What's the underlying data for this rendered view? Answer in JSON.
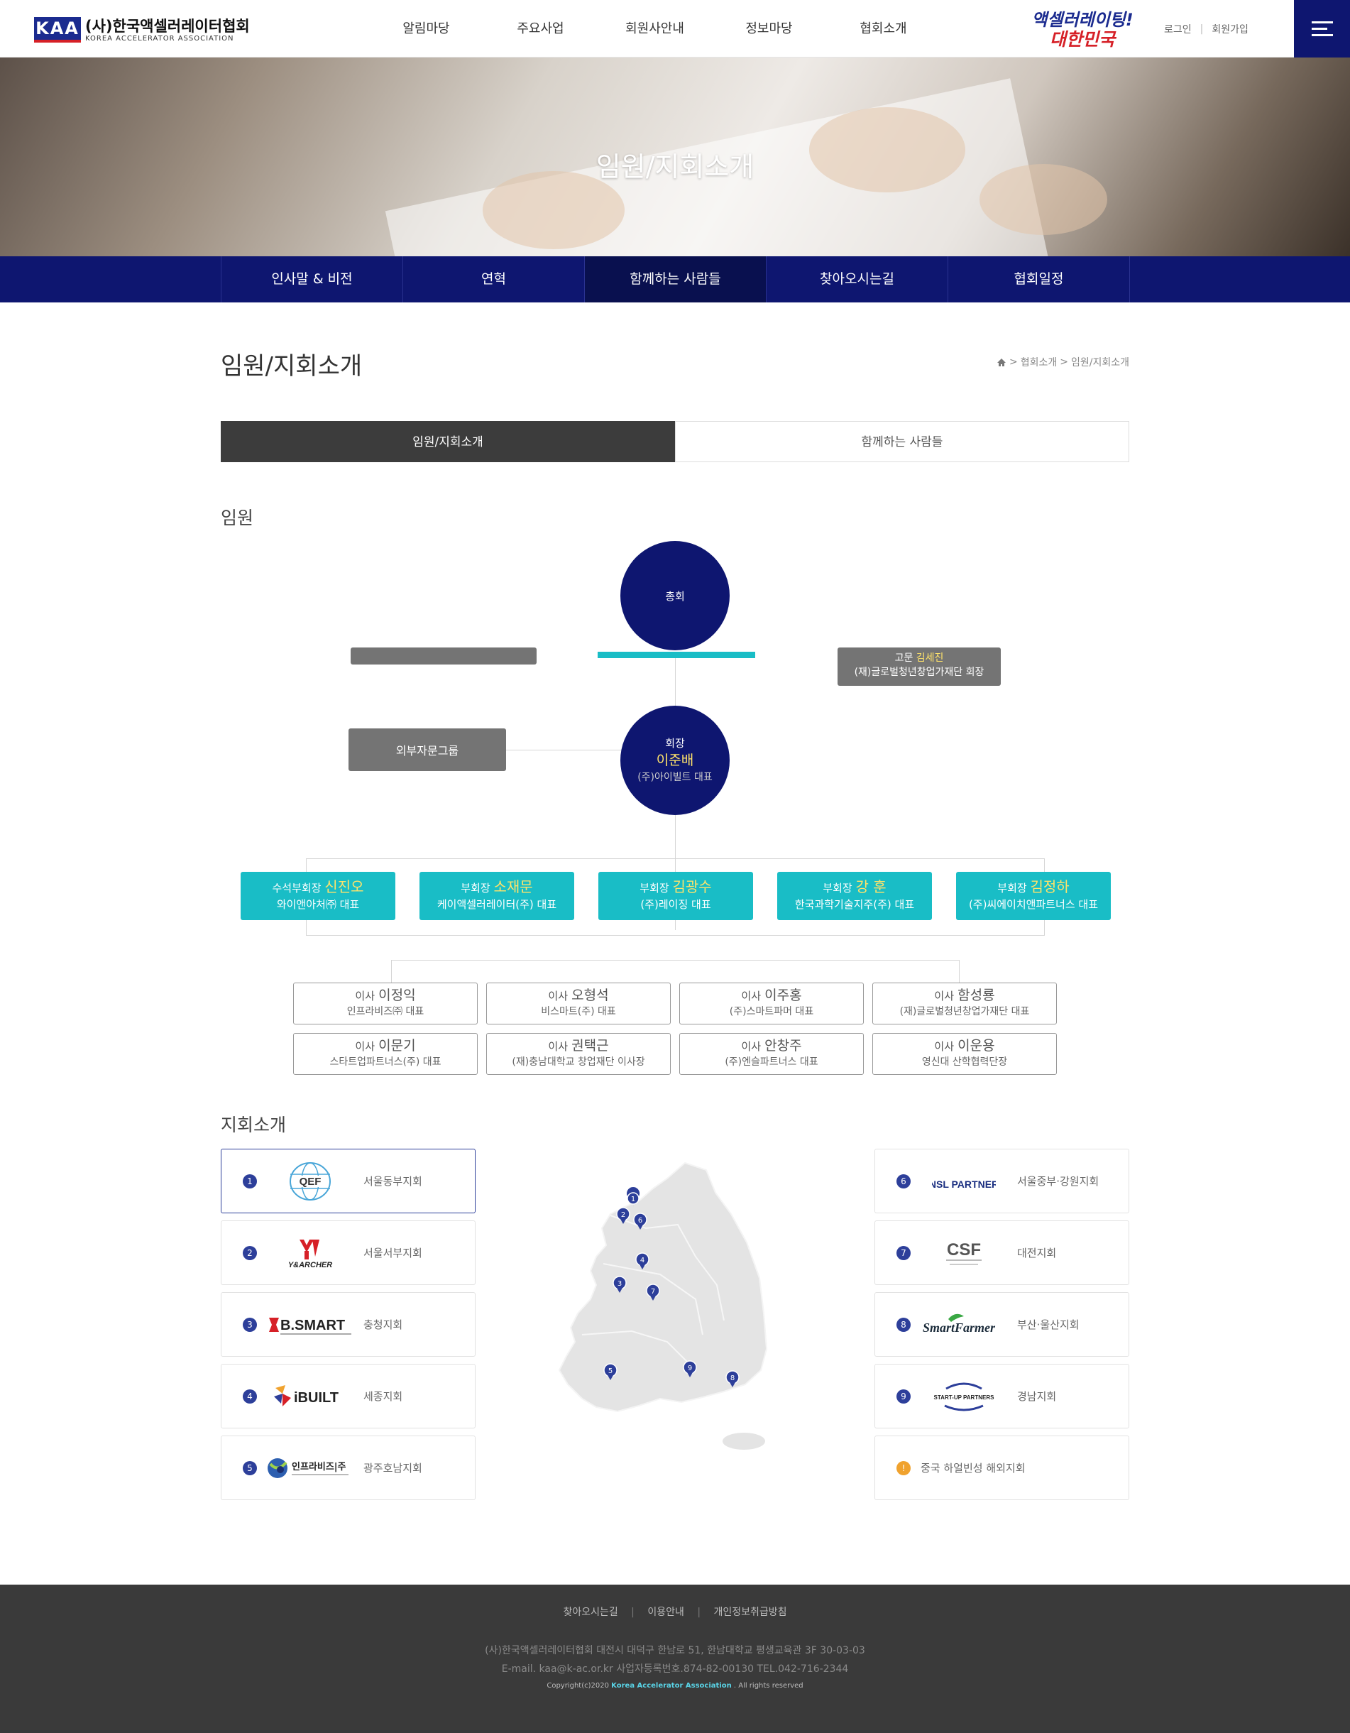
{
  "header": {
    "logo_mark": "KAA",
    "logo_ko": "(사)한국액셀러레이터협회",
    "logo_en": "KOREA ACCELERATOR ASSOCIATION",
    "gnb": [
      "알림마당",
      "주요사업",
      "회원사안내",
      "정보마당",
      "협회소개"
    ],
    "slogan_1": "액셀러레이팅!",
    "slogan_2": "대한민국",
    "login": "로그인",
    "join": "회원가입"
  },
  "hero": {
    "title": "임원/지회소개"
  },
  "subnav": [
    "인사말 & 비전",
    "연혁",
    "함께하는 사람들",
    "찾아오시는길",
    "협회일정"
  ],
  "page": {
    "title": "임원/지회소개",
    "breadcrumb": [
      "협회소개",
      "임원/지회소개"
    ]
  },
  "tabs": [
    "임원/지회소개",
    "함께하는 사람들"
  ],
  "org": {
    "section_title": "임원",
    "general_meeting": "총회",
    "advisor_box": {
      "title": "고문",
      "name": "김세진",
      "company": "(재)글로벌청년창업가재단 회장"
    },
    "president": {
      "title": "회장",
      "name": "이준배",
      "company": "(주)아이빌트 대표"
    },
    "external_group": "외부자문그룹",
    "vice_presidents": [
      {
        "title": "수석부회장",
        "name": "신진오",
        "company": "와이앤아처㈜ 대표"
      },
      {
        "title": "부회장",
        "name": "소재문",
        "company": "케이액셀러레이터(주) 대표"
      },
      {
        "title": "부회장",
        "name": "김광수",
        "company": "(주)레이징 대표"
      },
      {
        "title": "부회장",
        "name": "강 훈",
        "company": "한국과학기술지주(주) 대표"
      },
      {
        "title": "부회장",
        "name": "김정하",
        "company": "(주)씨에이치앤파트너스 대표"
      }
    ],
    "directors": [
      {
        "title": "이사",
        "name": "이정익",
        "company": "인프라비즈㈜ 대표"
      },
      {
        "title": "이사",
        "name": "오형석",
        "company": "비스마트(주) 대표"
      },
      {
        "title": "이사",
        "name": "이주홍",
        "company": "(주)스마트파머 대표"
      },
      {
        "title": "이사",
        "name": "함성룡",
        "company": "(재)글로벌청년창업가재단 대표"
      },
      {
        "title": "이사",
        "name": "이문기",
        "company": "스타트업파트너스(주) 대표"
      },
      {
        "title": "이사",
        "name": "권택근",
        "company": "(재)충남대학교 창업재단 이사장"
      },
      {
        "title": "이사",
        "name": "안창주",
        "company": "(주)엔슬파트너스 대표"
      },
      {
        "title": "이사",
        "name": "이운용",
        "company": "영신대 산학협력단장"
      }
    ]
  },
  "branches": {
    "section_title": "지회소개",
    "left": [
      {
        "num": "1",
        "logo": "QEF",
        "name": "서울동부지회"
      },
      {
        "num": "2",
        "logo": "Y&ARCHER",
        "name": "서울서부지회"
      },
      {
        "num": "3",
        "logo": "B.SMART",
        "name": "충청지회"
      },
      {
        "num": "4",
        "logo": "iBUILT",
        "name": "세종지회"
      },
      {
        "num": "5",
        "logo": "인프라비즈|주",
        "name": "광주호남지회"
      }
    ],
    "right": [
      {
        "num": "6",
        "logo": "ENSL PARTNERS",
        "name": "서울중부·강원지회"
      },
      {
        "num": "7",
        "logo": "CSF",
        "name": "대전지회"
      },
      {
        "num": "8",
        "logo": "SmartFarmer",
        "name": "부산·울산지회"
      },
      {
        "num": "9",
        "logo": "START-UP PARTNERS",
        "name": "경남지회"
      },
      {
        "num": "!",
        "logo": "",
        "name": "중국 하얼빈성 해외지회"
      }
    ],
    "map_pins": [
      "1",
      "2",
      "6",
      "4",
      "3",
      "7",
      "5",
      "9",
      "8"
    ]
  },
  "footer": {
    "links": [
      "찾아오시는길",
      "이용안내",
      "개인정보취급방침"
    ],
    "address": "(사)한국액셀러레이터협회 대전시 대덕구 한남로 51, 한남대학교 평생교육관 3F 30-03-03",
    "contact": "E-mail. kaa@k-ac.or.kr 사업자등록번호.874-82-00130 TEL.042-716-2344",
    "copy_pre": "Copyright(c)2020",
    "copy_brand": "Korea Accelerator Association",
    "copy_post": ". All rights reserved"
  },
  "colors": {
    "navy": "#0e1670",
    "teal": "#19bdc6",
    "gray_box": "#747474",
    "dark_tab": "#3c3c3c",
    "accent_yellow": "#ffe36a"
  }
}
